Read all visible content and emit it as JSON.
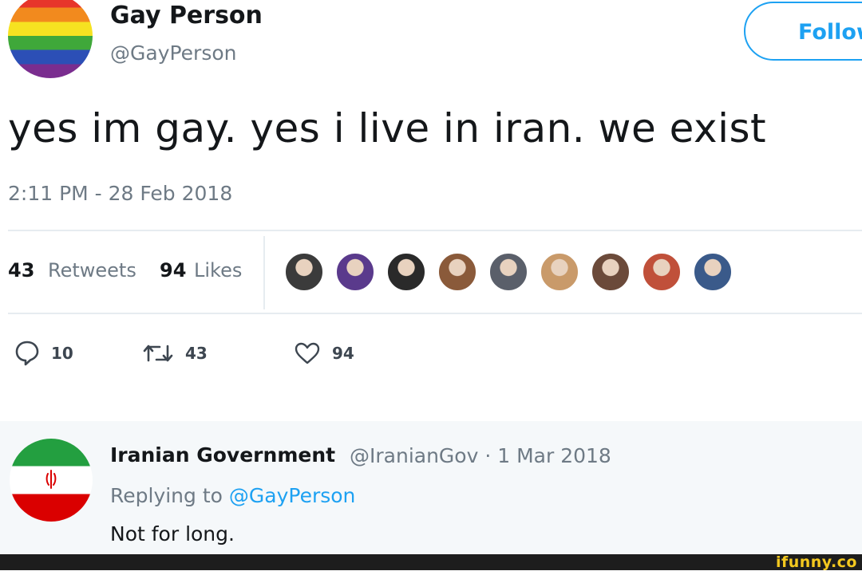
{
  "tweet": {
    "author_name": "Gay Person",
    "author_handle": "@GayPerson",
    "follow_label": "Follow",
    "text": "yes im gay. yes i live in iran. we exist",
    "timestamp": "2:11 PM - 28 Feb 2018",
    "stats": {
      "retweets_count": "43",
      "retweets_label": "Retweets",
      "likes_count": "94",
      "likes_label": "Likes"
    },
    "liker_avatars": [
      {
        "color": "#3b3b3b"
      },
      {
        "color": "#5a3a8c"
      },
      {
        "color": "#2a2a2a"
      },
      {
        "color": "#8a5a3a"
      },
      {
        "color": "#5a5f6a"
      },
      {
        "color": "#c99a6a"
      },
      {
        "color": "#6b4a3a"
      },
      {
        "color": "#c0503a"
      },
      {
        "color": "#3a5a8a"
      }
    ],
    "actions": {
      "reply_icon": "speech-bubble-icon",
      "reply_count": "10",
      "retweet_icon": "retweet-arrows-icon",
      "retweet_count": "43",
      "like_icon": "heart-icon",
      "like_count": "94"
    },
    "colors": {
      "accent": "#1da1f2",
      "muted": "#6e7a85",
      "text": "#14171a"
    }
  },
  "reply": {
    "author_name": "Iranian Government",
    "handle_date": "@IranianGov · 1 Mar 2018",
    "replying_prefix": "Replying to",
    "replying_handle": "@GayPerson",
    "text": "Not for long."
  },
  "watermark": "ifunny.co"
}
